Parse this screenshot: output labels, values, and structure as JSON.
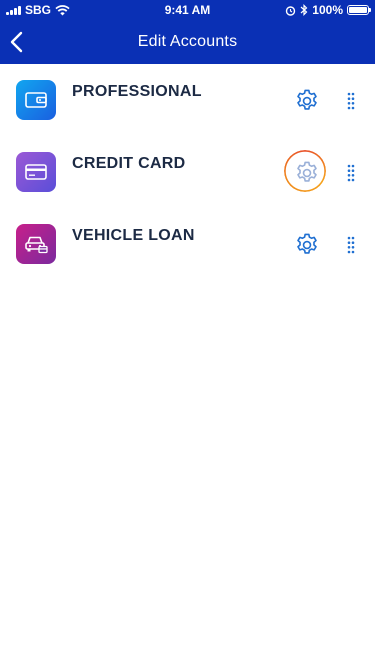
{
  "status_bar": {
    "carrier": "SBG",
    "time": "9:41 AM",
    "battery": "100%"
  },
  "header": {
    "title": "Edit Accounts"
  },
  "accounts": [
    {
      "label": "PROFESSIONAL",
      "icon": "wallet-icon",
      "tile_colors": [
        "#11a6f0",
        "#1a5fe0"
      ],
      "highlighted": false
    },
    {
      "label": "CREDIT CARD",
      "icon": "credit-card-icon",
      "tile_colors": [
        "#9b59d6",
        "#5a4ed8"
      ],
      "highlighted": true
    },
    {
      "label": "VEHICLE LOAN",
      "icon": "car-icon",
      "tile_colors": [
        "#c71f8a",
        "#7b2a9e"
      ],
      "highlighted": false
    }
  ],
  "colors": {
    "header_bg": "#0a30b5",
    "gear": "#1f6fd1",
    "gear_highlighted": "#9ab0d8",
    "label": "#1c2a44",
    "drag_handle": "#1f6fd1",
    "highlight_ring": "#e8502a"
  }
}
